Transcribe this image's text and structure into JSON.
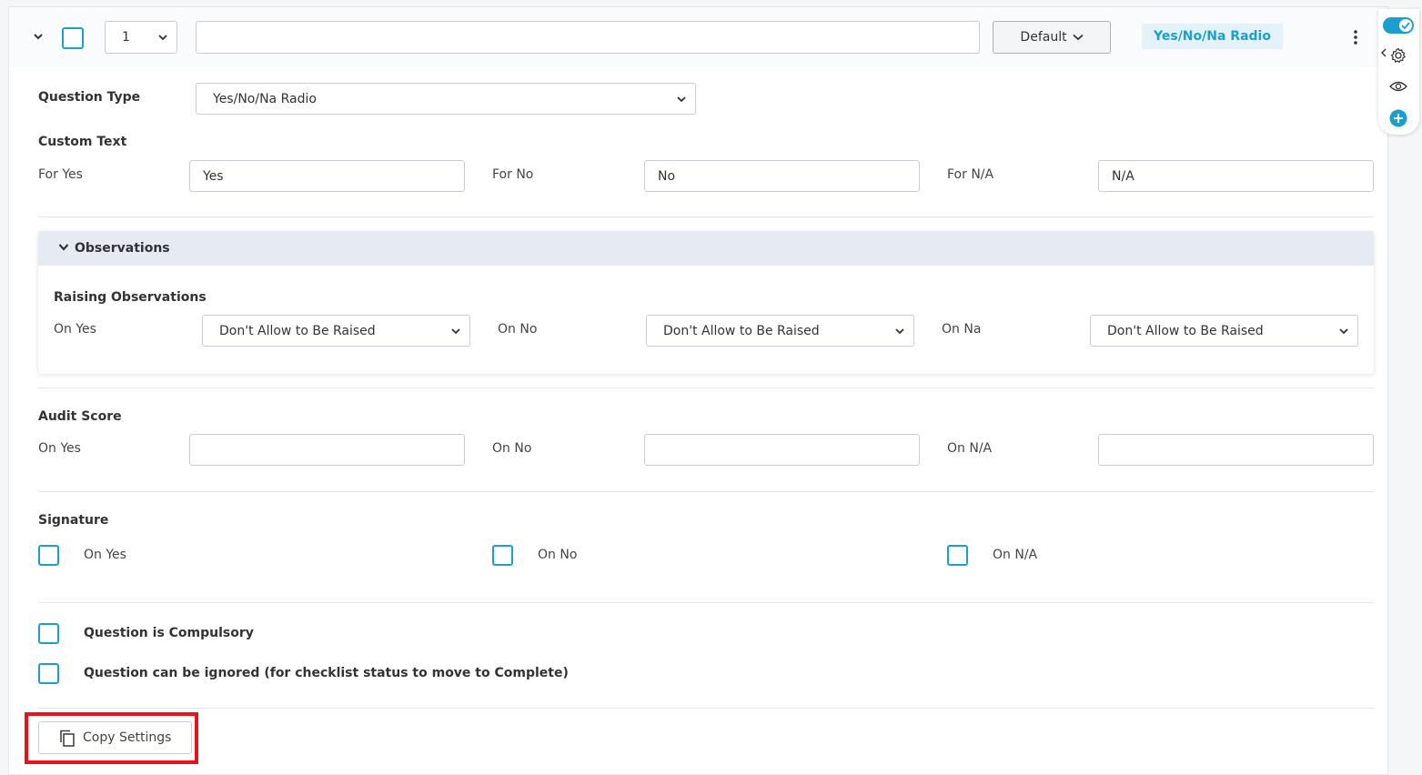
{
  "header": {
    "number_select_value": "1",
    "title_input_value": "",
    "default_button_label": "Default",
    "type_badge": "Yes/No/Na Radio"
  },
  "question_type": {
    "label": "Question Type",
    "value": "Yes/No/Na Radio"
  },
  "custom_text": {
    "section_label": "Custom Text",
    "for_yes_label": "For Yes",
    "for_yes_value": "Yes",
    "for_no_label": "For No",
    "for_no_value": "No",
    "for_na_label": "For N/A",
    "for_na_value": "N/A"
  },
  "observations": {
    "title": "Observations",
    "raising_label": "Raising Observations",
    "on_yes_label": "On Yes",
    "on_yes_value": "Don't Allow to Be Raised",
    "on_no_label": "On No",
    "on_no_value": "Don't Allow to Be Raised",
    "on_na_label": "On Na",
    "on_na_value": "Don't Allow to Be Raised"
  },
  "audit_score": {
    "section_label": "Audit Score",
    "on_yes_label": "On Yes",
    "on_yes_value": "",
    "on_no_label": "On No",
    "on_no_value": "",
    "on_na_label": "On N/A",
    "on_na_value": ""
  },
  "signature": {
    "section_label": "Signature",
    "on_yes_label": "On Yes",
    "on_no_label": "On No",
    "on_na_label": "On N/A"
  },
  "options": {
    "compulsory_label": "Question is Compulsory",
    "ignorable_label": "Question can be ignored (for checklist status to move to Complete)"
  },
  "footer": {
    "copy_settings_label": "Copy Settings"
  },
  "colors": {
    "accent": "#1b9fd1",
    "highlight": "#e8131a",
    "observations_header": "#e6ebf3"
  },
  "icons": {
    "collapse": "chevron-down-icon",
    "menu": "kebab-menu-icon",
    "settings": "gear-icon",
    "preview": "eye-icon",
    "add": "plus-circle-icon",
    "copy": "copy-icon"
  }
}
